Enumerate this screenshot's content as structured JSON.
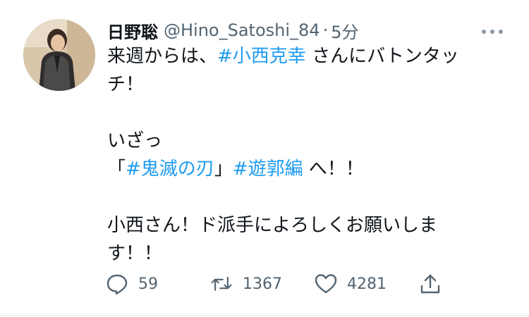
{
  "tweet": {
    "display_name": "日野聡",
    "handle": "@Hino_Satoshi_84",
    "separator": "·",
    "time": "5分",
    "lines": [
      {
        "parts": [
          {
            "t": "来週からは、"
          },
          {
            "t": "#小西克幸",
            "tag": true
          },
          {
            "t": " さんにバトンタッ"
          }
        ]
      },
      {
        "parts": [
          {
            "t": "チ！"
          }
        ]
      },
      {
        "parts": []
      },
      {
        "parts": [
          {
            "t": "いざっ"
          }
        ]
      },
      {
        "parts": [
          {
            "t": "「"
          },
          {
            "t": "#鬼滅の刃",
            "tag": true
          },
          {
            "t": "」"
          },
          {
            "t": "#遊郭編",
            "tag": true
          },
          {
            "t": " へ！！"
          }
        ]
      },
      {
        "parts": []
      },
      {
        "parts": [
          {
            "t": "小西さん！ド派手によろしくお願いしま"
          }
        ]
      },
      {
        "parts": [
          {
            "t": "す！！"
          }
        ]
      }
    ]
  },
  "actions": {
    "reply_count": "59",
    "retweet_count": "1367",
    "like_count": "4281"
  },
  "colors": {
    "link": "#1d9bf0",
    "muted": "#536471",
    "text": "#0f1419"
  },
  "icons": [
    "reply-icon",
    "retweet-icon",
    "like-icon",
    "share-icon",
    "more-icon"
  ]
}
